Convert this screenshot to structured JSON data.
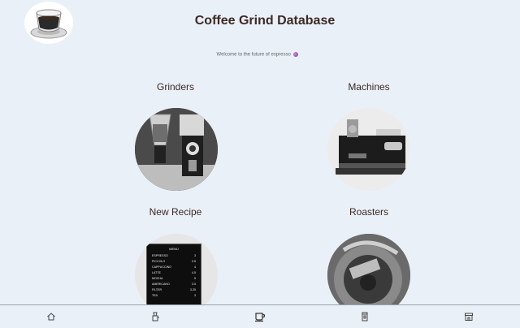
{
  "header": {
    "title": "Coffee Grind Database",
    "subtitle": "Welcome to the future of espresso"
  },
  "sections": [
    {
      "label": "Grinders"
    },
    {
      "label": "Machines"
    },
    {
      "label": "New Recipe"
    },
    {
      "label": "Roasters"
    }
  ],
  "menu_board": {
    "title": "MENU",
    "items": [
      {
        "name": "ESPRESSO",
        "price": "3"
      },
      {
        "name": "PICCOLO",
        "price": "3.5"
      },
      {
        "name": "CAPPUCCINO",
        "price": "4"
      },
      {
        "name": "LATTE",
        "price": "4.5"
      },
      {
        "name": "MOCHA",
        "price": "5"
      },
      {
        "name": "AMERICANO",
        "price": "3.5"
      },
      {
        "name": "FILTER",
        "price": "3.25"
      },
      {
        "name": "TEA",
        "price": "3"
      }
    ]
  },
  "nav": {
    "items": [
      {
        "icon": "home-icon"
      },
      {
        "icon": "grinder-icon"
      },
      {
        "icon": "coffee-cup-icon"
      },
      {
        "icon": "machine-icon"
      },
      {
        "icon": "store-icon"
      }
    ]
  }
}
